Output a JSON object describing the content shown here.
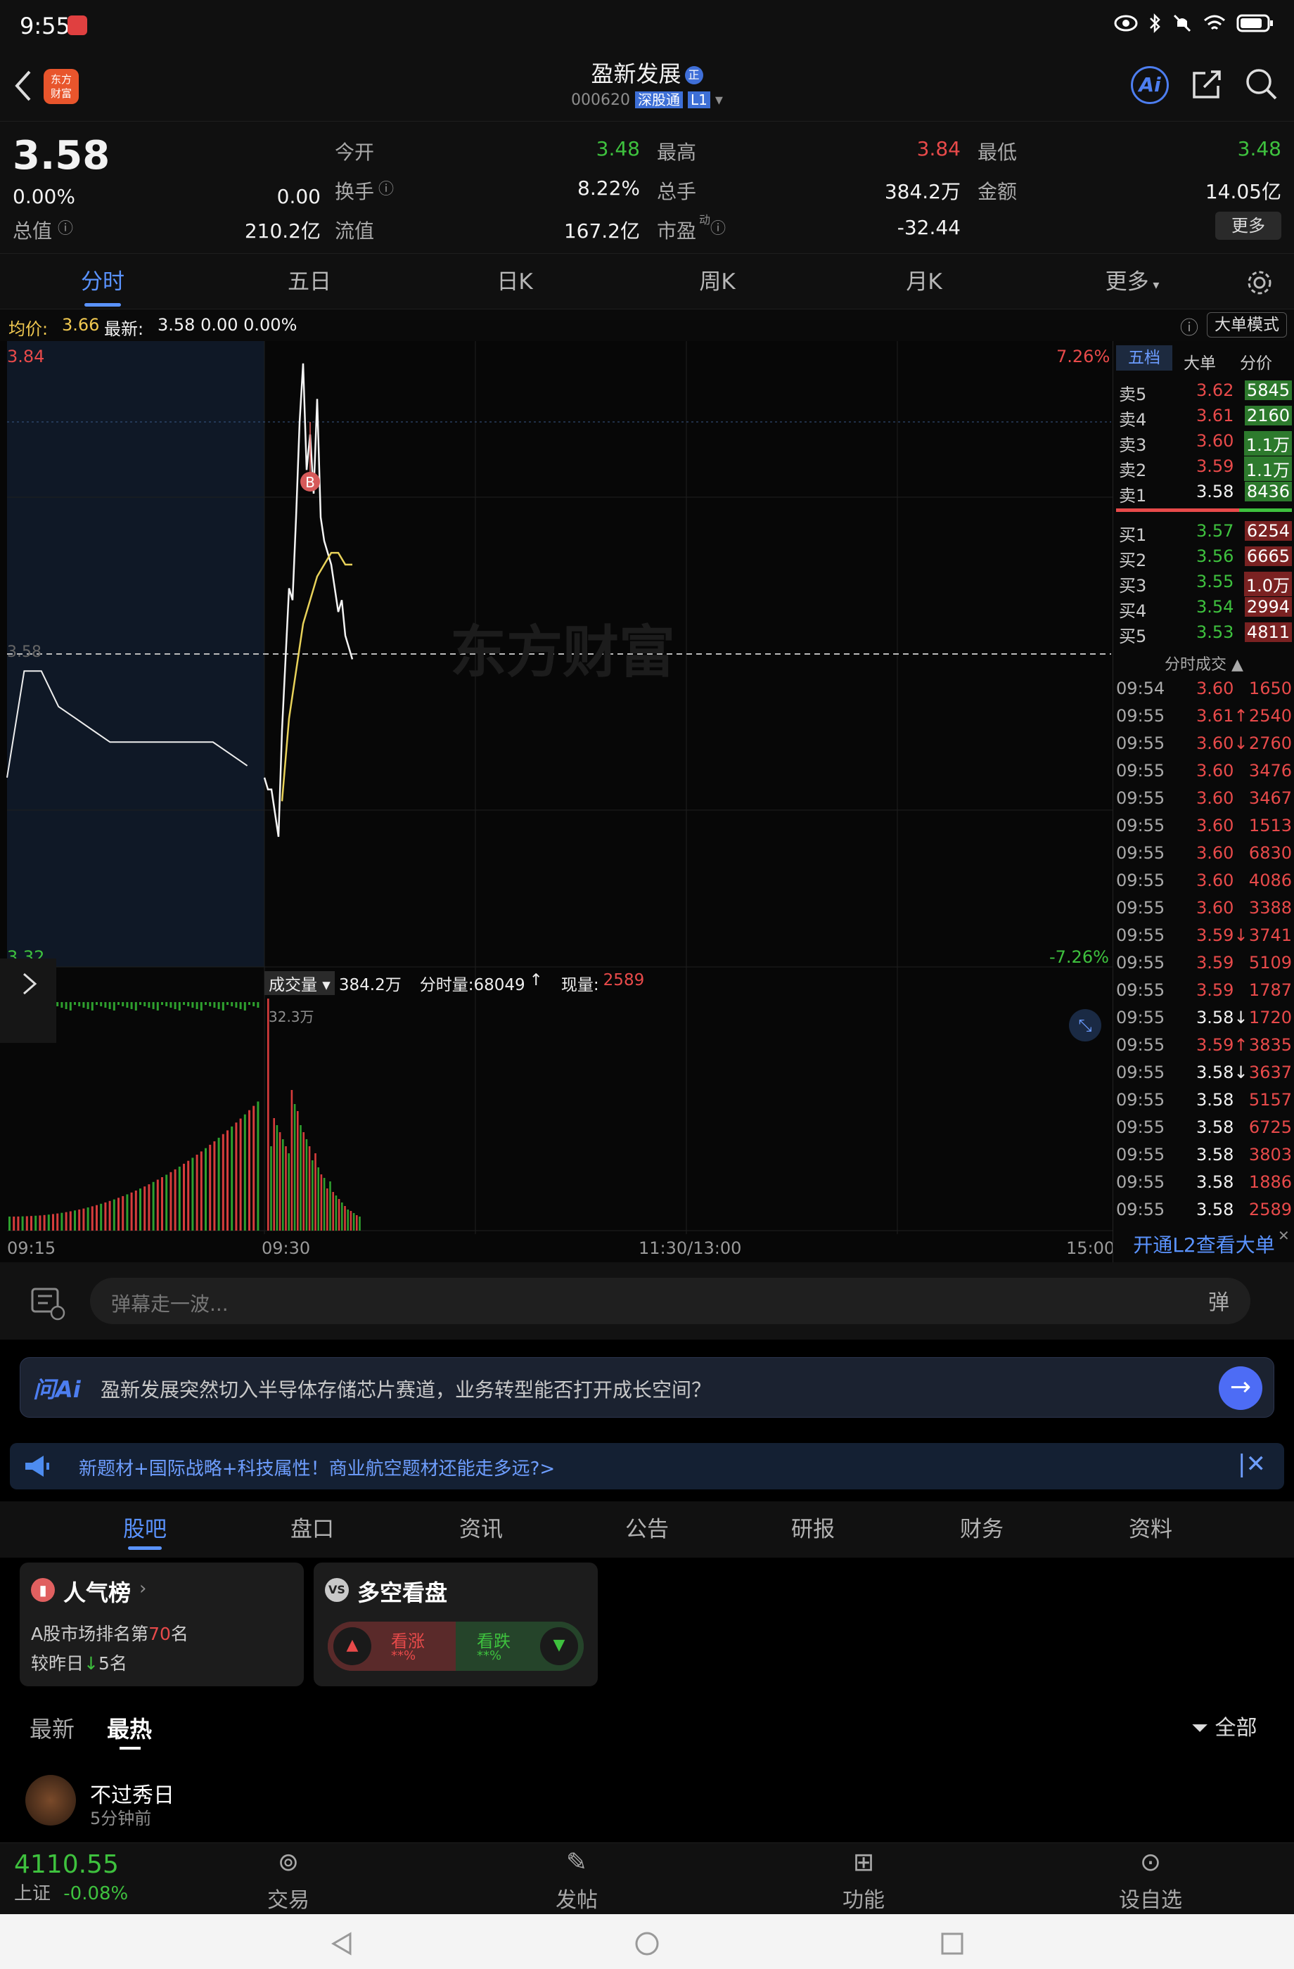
{
  "status": {
    "time": "9:55"
  },
  "header": {
    "name": "盈新发展",
    "code": "000620",
    "board": "深股通",
    "level": "L1",
    "ai_label": "Ai"
  },
  "quote": {
    "price": "3.58",
    "pct": "0.00%",
    "change": "0.00",
    "open_label": "今开",
    "open": "3.48",
    "high_label": "最高",
    "high": "3.84",
    "low_label": "最低",
    "low": "3.48",
    "turnover_label": "换手",
    "turnover": "8.22%",
    "volume_label": "总手",
    "volume": "384.2万",
    "amount_label": "金额",
    "amount": "14.05亿",
    "mcap_label": "总值",
    "mcap": "210.2亿",
    "float_label": "流值",
    "float": "167.2亿",
    "pe_label": "市盈",
    "pe_sup": "动",
    "pe": "-32.44",
    "more": "更多"
  },
  "tabs": [
    "分时",
    "五日",
    "日K",
    "周K",
    "月K",
    "更多"
  ],
  "chart_info": {
    "avg_label": "均价:",
    "avg": "3.66",
    "last_label": "最新:",
    "last": "3.58 0.00 0.00%",
    "mode": "大单模式"
  },
  "chart": {
    "y_high": "3.84",
    "y_low": "3.32",
    "y_mid": "3.58",
    "pct_high": "7.26%",
    "pct_low": "-7.26%",
    "vol_label": "成交量",
    "vol_total": "384.2万",
    "vol_minute": "分时量:68049",
    "vol_now_label": "现量:",
    "vol_now": "2589",
    "vol_max": "32.3万",
    "x_ticks": [
      "09:15",
      "09:30",
      "11:30/13:00",
      "15:00"
    ],
    "buy_marker": "B",
    "watermark": "东方财富"
  },
  "chart_data": {
    "type": "line",
    "series": [
      {
        "name": "最新",
        "x": [
          "09:15",
          "09:16",
          "09:17",
          "09:18",
          "09:19",
          "09:20",
          "09:21",
          "09:22",
          "09:23",
          "09:24",
          "09:25",
          "09:26",
          "09:27",
          "09:28",
          "09:29",
          "09:30",
          "09:31",
          "09:32",
          "09:33",
          "09:34",
          "09:35",
          "09:36",
          "09:37",
          "09:38",
          "09:39",
          "09:40",
          "09:41",
          "09:42",
          "09:43",
          "09:44",
          "09:45",
          "09:46",
          "09:47",
          "09:48",
          "09:49",
          "09:50",
          "09:51",
          "09:52",
          "09:53",
          "09:54",
          "09:55"
        ],
        "values": [
          3.48,
          3.57,
          3.57,
          3.54,
          3.53,
          3.52,
          3.51,
          3.51,
          3.51,
          3.51,
          3.51,
          3.51,
          3.51,
          3.5,
          3.49,
          3.48,
          3.47,
          3.47,
          3.45,
          3.43,
          3.52,
          3.58,
          3.64,
          3.63,
          3.7,
          3.78,
          3.83,
          3.74,
          3.77,
          3.72,
          3.8,
          3.7,
          3.68,
          3.67,
          3.66,
          3.64,
          3.62,
          3.63,
          3.6,
          3.59,
          3.58
        ]
      },
      {
        "name": "均价",
        "x": [
          "09:35",
          "09:37",
          "09:39",
          "09:41",
          "09:43",
          "09:45",
          "09:47",
          "09:49",
          "09:51",
          "09:53",
          "09:55"
        ],
        "values": [
          3.46,
          3.53,
          3.57,
          3.61,
          3.63,
          3.65,
          3.66,
          3.67,
          3.67,
          3.66,
          3.66
        ]
      }
    ],
    "ylim": [
      3.32,
      3.84
    ]
  },
  "orderbook": {
    "tabs": [
      "五档",
      "大单",
      "分价"
    ],
    "asks": [
      {
        "label": "卖5",
        "price": "3.62",
        "vol": "5845"
      },
      {
        "label": "卖4",
        "price": "3.61",
        "vol": "2160"
      },
      {
        "label": "卖3",
        "price": "3.60",
        "vol": "1.1万"
      },
      {
        "label": "卖2",
        "price": "3.59",
        "vol": "1.1万"
      },
      {
        "label": "卖1",
        "price": "3.58",
        "vol": "8436"
      }
    ],
    "bids": [
      {
        "label": "买1",
        "price": "3.57",
        "vol": "6254"
      },
      {
        "label": "买2",
        "price": "3.56",
        "vol": "6665"
      },
      {
        "label": "买3",
        "price": "3.55",
        "vol": "1.0万"
      },
      {
        "label": "买4",
        "price": "3.54",
        "vol": "2994"
      },
      {
        "label": "买5",
        "price": "3.53",
        "vol": "4811"
      }
    ],
    "trades_label": "分时成交"
  },
  "trades": [
    {
      "t": "09:54",
      "p": "3.60",
      "v": "1650",
      "c": "red"
    },
    {
      "t": "09:55",
      "p": "3.61↑",
      "v": "2540",
      "c": "red"
    },
    {
      "t": "09:55",
      "p": "3.60↓",
      "v": "2760",
      "c": "red"
    },
    {
      "t": "09:55",
      "p": "3.60",
      "v": "3476",
      "c": "red"
    },
    {
      "t": "09:55",
      "p": "3.60",
      "v": "3467",
      "c": "red"
    },
    {
      "t": "09:55",
      "p": "3.60",
      "v": "1513",
      "c": "red"
    },
    {
      "t": "09:55",
      "p": "3.60",
      "v": "6830",
      "c": "red"
    },
    {
      "t": "09:55",
      "p": "3.60",
      "v": "4086",
      "c": "red"
    },
    {
      "t": "09:55",
      "p": "3.60",
      "v": "3388",
      "c": "red"
    },
    {
      "t": "09:55",
      "p": "3.59↓",
      "v": "3741",
      "c": "red"
    },
    {
      "t": "09:55",
      "p": "3.59",
      "v": "5109",
      "c": "red"
    },
    {
      "t": "09:55",
      "p": "3.59",
      "v": "1787",
      "c": "red"
    },
    {
      "t": "09:55",
      "p": "3.58↓",
      "v": "1720",
      "c": "white"
    },
    {
      "t": "09:55",
      "p": "3.59↑",
      "v": "3835",
      "c": "red"
    },
    {
      "t": "09:55",
      "p": "3.58↓",
      "v": "3637",
      "c": "white"
    },
    {
      "t": "09:55",
      "p": "3.58",
      "v": "5157",
      "c": "white"
    },
    {
      "t": "09:55",
      "p": "3.58",
      "v": "6725",
      "c": "white"
    },
    {
      "t": "09:55",
      "p": "3.58",
      "v": "3803",
      "c": "white"
    },
    {
      "t": "09:55",
      "p": "3.58",
      "v": "1886",
      "c": "white"
    },
    {
      "t": "09:55",
      "p": "3.58",
      "v": "2589",
      "c": "white"
    }
  ],
  "l2_banner": "开通L2查看大单",
  "danmaku": {
    "placeholder": "弹幕走一波..."
  },
  "ai_bar": {
    "badge": "问Ai",
    "question": "盈新发展突然切入半导体存储芯片赛道，业务转型能否打开成长空间？"
  },
  "notice": {
    "text": "新题材+国际战略+科技属性！商业航空题材还能走多远?>"
  },
  "subtabs": [
    "股吧",
    "盘口",
    "资讯",
    "公告",
    "研报",
    "财务",
    "资料"
  ],
  "popularity": {
    "title": "人气榜",
    "line1": "A股市场排名第",
    "rank": "70",
    "line1_suffix": "名",
    "line2": "较昨日",
    "delta": "5",
    "line2_suffix": "名"
  },
  "sentiment": {
    "title": "多空看盘",
    "bull": "看涨",
    "bear": "看跌",
    "bull_pct": "**%",
    "bear_pct": "**%"
  },
  "feed": {
    "sort_new": "最新",
    "sort_hot": "最热",
    "filter": "全部",
    "post_user": "不过秀日",
    "post_time": "5分钟前"
  },
  "index": {
    "value": "4110.55",
    "name": "上证",
    "pct": "-0.08%"
  },
  "bottomnav": [
    "交易",
    "发帖",
    "功能",
    "设自选"
  ],
  "colors": {
    "up": "#e84a4a",
    "down": "#3ec13e",
    "accent": "#5a93ff"
  }
}
